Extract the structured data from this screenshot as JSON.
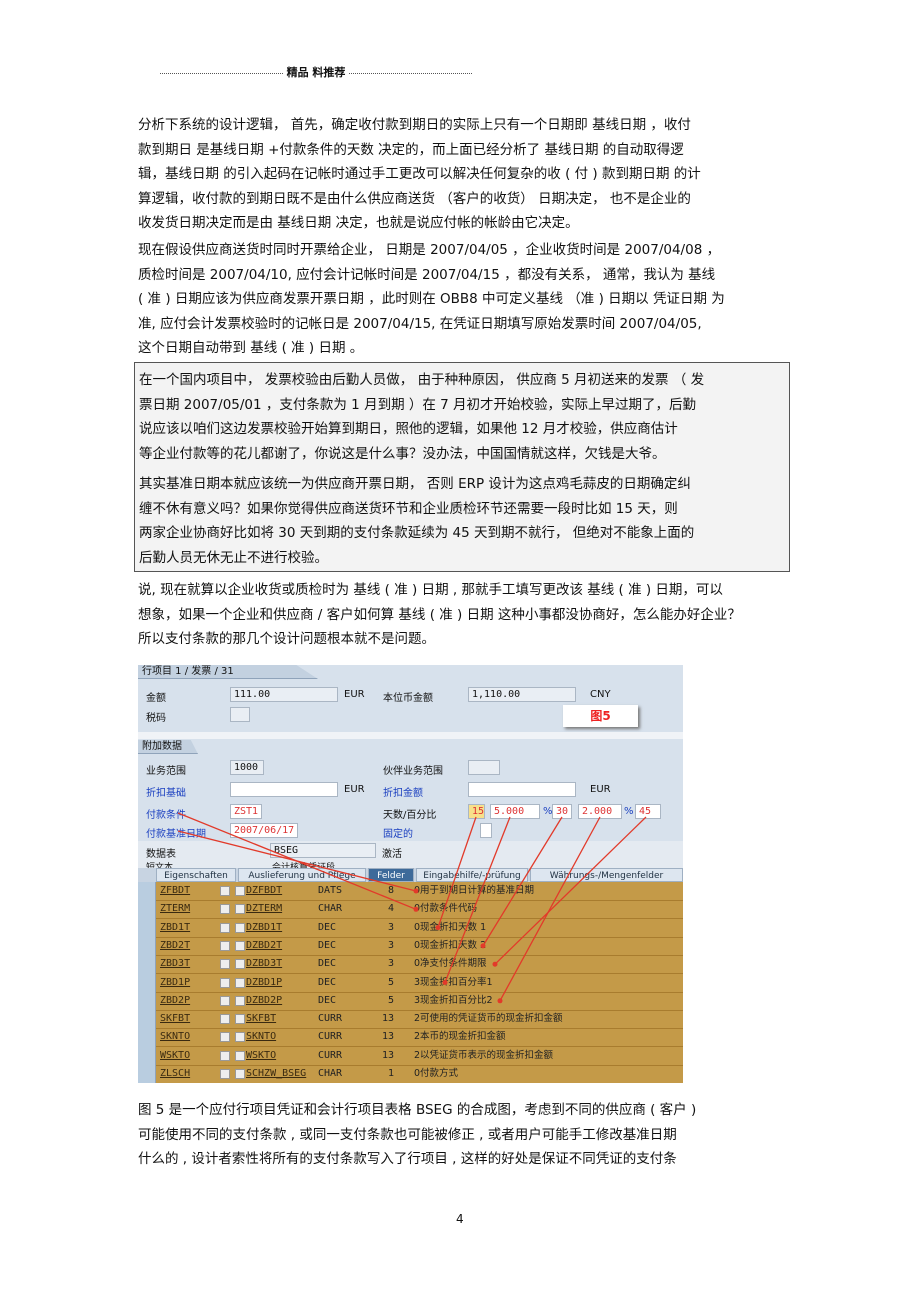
{
  "header": {
    "title": "精品 料推荐"
  },
  "paragraphs": {
    "p1": [
      "分析下系统的设计逻辑，    首先，确定收付款到期日的实际上只有一个日期即        基线日期 ，收付",
      "款到期日  是基线日期 +付款条件的天数   决定的，而上面已经分析了      基线日期  的自动取得逻",
      "辑，基线日期  的引入起码在记帐时通过手工更改可以解决任何复杂的收        ( 付 ) 款到期日期  的计",
      "算逻辑，收付款的到期日既不是由什么供应商送货          （客户的收货）  日期决定，   也不是企业的",
      "收发货日期决定而是由     基线日期  决定，也就是说应付帐的帐龄由它决定。"
    ],
    "p2": [
      "现在假设供应商送货时同时开票给企业，          日期是 2007/04/05 ，企业收货时间是   2007/04/08 ，",
      "质检时间是  2007/04/10,      应付会计记帐时间是       2007/04/15 ，都没有关系，  通常，我认为  基线",
      "( 准 ) 日期应该为供应商发票开票日期          ，此时则在  OBB8 中可定义基线 （准 ) 日期以  凭证日期  为",
      "准, 应付会计发票校验时的记帐日是          2007/04/15,    在凭证日期填写原始发票时间        2007/04/05,",
      "这个日期自动带到    基线 ( 准 ) 日期 。"
    ],
    "box1": [
      "在一个国内项目中，        发票校验由后勤人员做，       由于种种原因，      供应商  5 月初送来的发票  （ 发",
      "票日期 2007/05/01 ，支付条款为        1 月到期 ）在 7 月初才开始校验，实际上早过期了，后勤",
      "说应该以咱们这边发票校验开始算到期日，照他的逻辑，如果他                12 月才校验，供应商估计",
      "等企业付款等的花儿都谢了，你说这是什么事？没办法，中国国情就这样，欠钱是大爷。"
    ],
    "box2": [
      "其实基准日期本就应该统一为供应商开票日期，              否则 ERP 设计为这点鸡毛蒜皮的日期确定纠",
      "缠不休有意义吗？如果你觉得供应商送货环节和企业质检环节还需要一段时比如                  15 天，则",
      "两家企业协商好比如将       30 天到期的支付条款延续为          45 天到期不就行，  但绝对不能象上面的",
      "后勤人员无休无止不进行校验。"
    ],
    "p3": [
      "说, 现在就算以企业收货或质检时为  基线 ( 准 ) 日期 , 那就手工填写更改该  基线 ( 准 ) 日期，可以",
      "想象，如果一个企业和供应商 / 客户如何算  基线 ( 准 ) 日期  这种小事都没协商好，怎么能办好企业？",
      "所以支付条款的那几个设计问题根本就不是问题。"
    ],
    "caption": [
      "图 5 是一个应付行项目凭证和会计行项目表格          BSEG 的合成图，考虑到不同的供应商     ( 客户 )",
      "可能使用不同的支付条款   , 或同一支付条款也可能被修正      , 或者用户可能手工修改基准日期",
      "什么的 , 设计者索性将所有的支付条款写入了行项目        , 这样的好处是保证不同凭证的支付条"
    ]
  },
  "sap": {
    "section1_title": "行项目 1 / 发票 / 31",
    "amount_label": "金额",
    "amount_value": "111.00",
    "amount_currency": "EUR",
    "local_amount_label": "本位币金额",
    "local_amount_value": "1,110.00",
    "local_currency": "CNY",
    "tax_code_label": "税码",
    "figure_label": "图5",
    "section2_title": "附加数据",
    "business_area_label": "业务范围",
    "business_area_value": "1000",
    "partner_ba_label": "伙伴业务范围",
    "discount_base_label": "折扣基础",
    "discount_base_currency": "EUR",
    "discount_amount_label": "折扣金额",
    "discount_amount_currency": "EUR",
    "payment_terms_label": "付款条件",
    "payment_terms_value": "ZST1",
    "days_pct_label": "天数/百分比",
    "days1": "15",
    "pct1": "5.000",
    "pct_sign": "%",
    "days2": "30",
    "pct2": "2.000",
    "days3": "45",
    "baseline_label": "付款基准日期",
    "baseline_value": "2007/06/17",
    "fixed_label": "固定的",
    "table_label": "数据表",
    "table_value": "BSEG",
    "active_label": "激活",
    "short_text_label": "短文本",
    "short_text_value": "会计核算凭证段",
    "tabs": [
      "Eigenschaften",
      "Auslieferung und Pflege",
      "Felder",
      "Eingabehilfe/-prüfung",
      "Währungs-/Mengenfelder"
    ],
    "rows": [
      [
        "ZFBDT",
        "DZFBDT",
        "DATS",
        "8",
        "0用于到期日计算的基准日期"
      ],
      [
        "ZTERM",
        "DZTERM",
        "CHAR",
        "4",
        "0付款条件代码"
      ],
      [
        "ZBD1T",
        "DZBD1T",
        "DEC",
        "3",
        "0现金折扣天数 1"
      ],
      [
        "ZBD2T",
        "DZBD2T",
        "DEC",
        "3",
        "0现金折扣天数 2"
      ],
      [
        "ZBD3T",
        "DZBD3T",
        "DEC",
        "3",
        "0净支付条件期限"
      ],
      [
        "ZBD1P",
        "DZBD1P",
        "DEC",
        "5",
        "3现金折扣百分率1"
      ],
      [
        "ZBD2P",
        "DZBD2P",
        "DEC",
        "5",
        "3现金折扣百分比2"
      ],
      [
        "SKFBT",
        "SKFBT",
        "CURR",
        "13",
        "2可使用的凭证货币的现金折扣金额"
      ],
      [
        "SKNTO",
        "SKNTO",
        "CURR",
        "13",
        "2本币的现金折扣金额"
      ],
      [
        "WSKTO",
        "WSKTO",
        "CURR",
        "13",
        "2以凭证货币表示的现金折扣金额"
      ],
      [
        "ZLSCH",
        "SCHZW_BSEG",
        "CHAR",
        "1",
        "0付款方式"
      ]
    ],
    "colors": {
      "background": "#d7e1ec",
      "table": "#c49a48",
      "selected_tab": "#3d6a9a",
      "arrow": "#e23a2a"
    }
  },
  "footer": {
    "page_number": "4"
  }
}
